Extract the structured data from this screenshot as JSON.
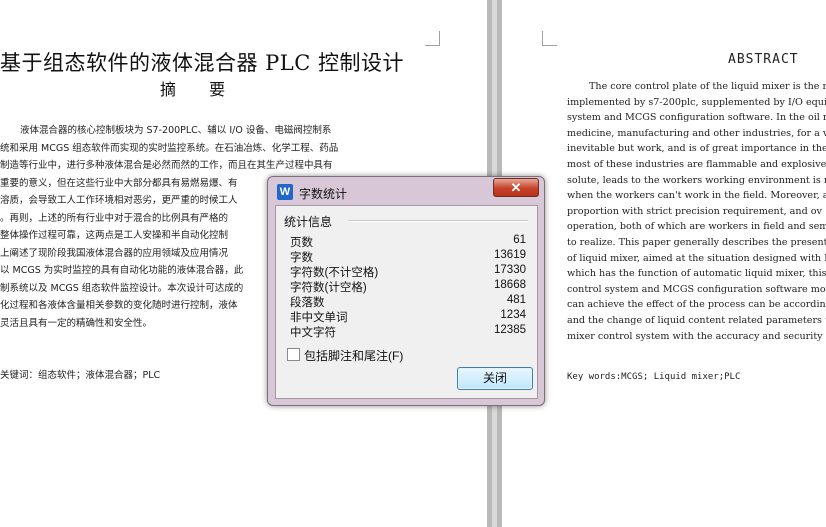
{
  "left_page": {
    "title": "基于组态软件的液体混合器 PLC 控制设计",
    "subtitle": "摘 要",
    "lines": [
      "液体混合器的核心控制板块为 S7-200PLC、辅以 I/O 设备、电磁阀控制系",
      "统和采用 MCGS 组态软件而实现的实时监控系统。在石油冶炼、化学工程、药品",
      "制造等行业中，进行多种液体混合是必然而然的工作，而且在其生产过程中具有",
      "重要的意义，但在这些行业中大部分都具有易燃易爆、有",
      "溶质，会导致工人工作环境相对恶劣，更严重的时候工人",
      "。再则，上述的所有行业中对于混合的比例具有严格的",
      "整体操作过程可靠，这两点是工人安操和半自动化控制",
      "上阐述了现阶段我国液体混合器的应用领域及应用情况",
      "以 MCGS 为实时监控的具有自动化功能的液体混合器，此",
      "制系统以及 MCGS 组态软件监控设计。本次设计可达成的",
      "化过程和各液体含量相关参数的变化随时进行控制，液体",
      "灵活且具有一定的精确性和安全性。"
    ],
    "keywords": "关键词：组态软件；液体混合器；PLC"
  },
  "right_page": {
    "title": "ABSTRACT",
    "lines": [
      "The core control plate of the liquid mixer is the m",
      "implemented by s7-200plc, supplemented by I/O equipm",
      "system and MCGS configuration software. In the oil refi",
      "medicine, manufacturing and other industries, for a v",
      "inevitable but work, and is of great importance in the proc",
      "most of these industries are flammable and explosive, tox",
      "solute, leads to the workers working environment is rela",
      "when the workers can't work in the field. Moreover, all of",
      "proportion with strict precision requirement, and ov",
      "operation, both of which are workers in field and semi-a",
      "to realize. This paper generally describes the present app",
      "of liquid mixer, aimed at the situation designed with MCG",
      "which has the function of automatic liquid mixer, this sys",
      "control system and MCGS configuration software mon",
      "can achieve the effect of the process can be according to",
      "and the change of liquid content related parameters to",
      "mixer control system with the accuracy and security of the"
    ],
    "keywords": "Key words:MCGS; Liquid mixer;PLC"
  },
  "dialog": {
    "app_icon": "W",
    "title": "字数统计",
    "close_glyph": "✕",
    "group_label": "统计信息",
    "stats": [
      {
        "label": "页数",
        "value": "61"
      },
      {
        "label": "字数",
        "value": "13619"
      },
      {
        "label": "字符数(不计空格)",
        "value": "17330"
      },
      {
        "label": "字符数(计空格)",
        "value": "18668"
      },
      {
        "label": "段落数",
        "value": "481"
      },
      {
        "label": "非中文单词",
        "value": "1234"
      },
      {
        "label": "中文字符",
        "value": "12385"
      }
    ],
    "checkbox_label": "包括脚注和尾注(F)",
    "checkbox_checked": false,
    "close_button_label": "关闭",
    "accent_color": "#d8c7d6",
    "icon_color": "#2266cc"
  }
}
